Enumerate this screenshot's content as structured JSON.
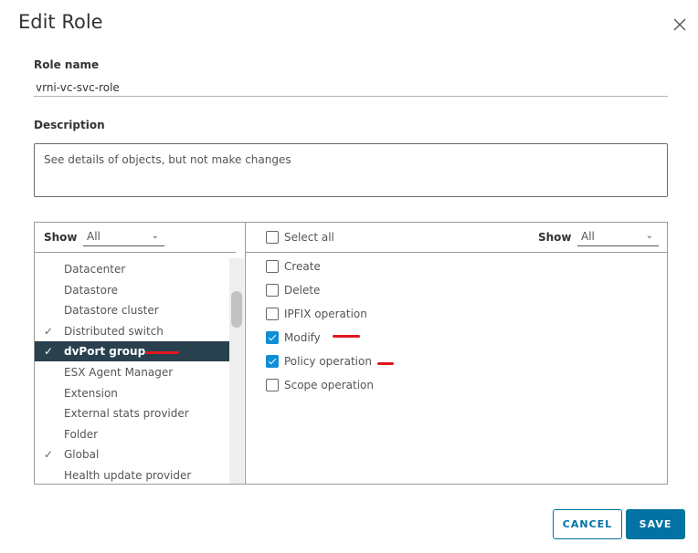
{
  "dialog": {
    "title": "Edit Role",
    "close_icon": "close-icon"
  },
  "role_name": {
    "label": "Role name",
    "value": "vrni-vc-svc-role"
  },
  "description": {
    "label": "Description",
    "value": "See details of objects, but not make changes"
  },
  "left_pane": {
    "show_label": "Show",
    "show_value": "All",
    "items": [
      {
        "label": "Datacenter",
        "checked": false
      },
      {
        "label": "Datastore",
        "checked": false
      },
      {
        "label": "Datastore cluster",
        "checked": false
      },
      {
        "label": "Distributed switch",
        "checked": true
      },
      {
        "label": "dvPort group",
        "checked": true,
        "selected": true
      },
      {
        "label": "ESX Agent Manager",
        "checked": false
      },
      {
        "label": "Extension",
        "checked": false
      },
      {
        "label": "External stats provider",
        "checked": false
      },
      {
        "label": "Folder",
        "checked": false
      },
      {
        "label": "Global",
        "checked": true
      },
      {
        "label": "Health update provider",
        "checked": false
      }
    ]
  },
  "right_pane": {
    "select_all_label": "Select all",
    "show_label": "Show",
    "show_value": "All",
    "privileges": [
      {
        "label": "Create",
        "checked": false
      },
      {
        "label": "Delete",
        "checked": false
      },
      {
        "label": "IPFIX operation",
        "checked": false
      },
      {
        "label": "Modify",
        "checked": true
      },
      {
        "label": "Policy operation",
        "checked": true
      },
      {
        "label": "Scope operation",
        "checked": false
      }
    ]
  },
  "annotation_color": "#e0161e",
  "accent_color": "#0072a3",
  "buttons": {
    "cancel": "CANCEL",
    "save": "SAVE"
  }
}
